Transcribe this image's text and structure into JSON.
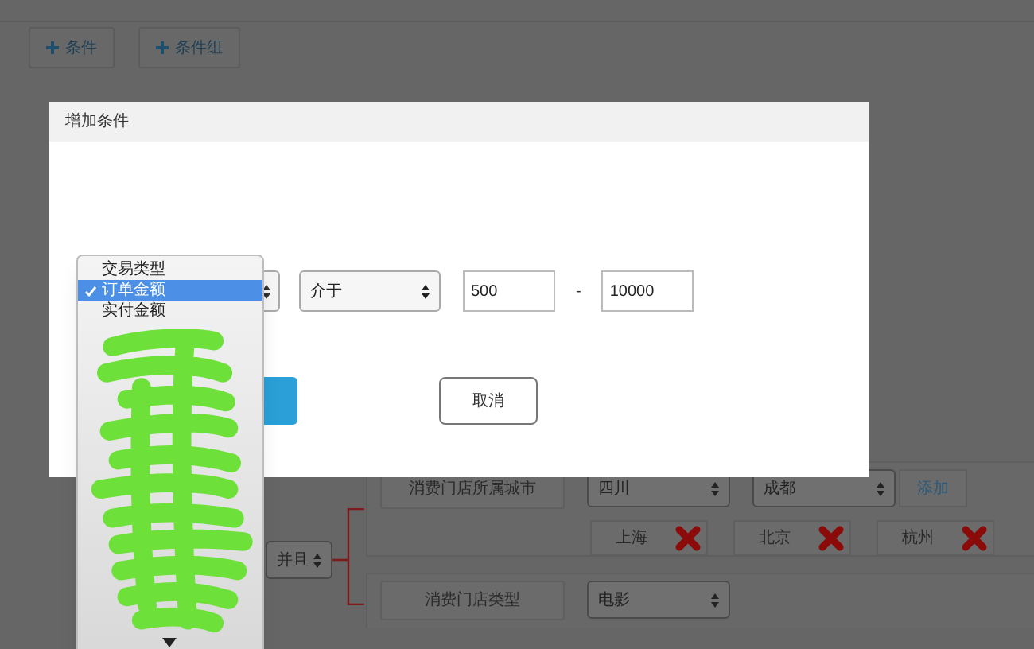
{
  "toolbar": [
    {
      "label": "条件"
    },
    {
      "label": "条件组"
    }
  ],
  "dialog": {
    "title": "增加条件",
    "field_options": [
      {
        "label": "交易类型",
        "selected": false
      },
      {
        "label": "订单金额",
        "selected": true
      },
      {
        "label": "实付金额",
        "selected": false
      }
    ],
    "operator": "介于",
    "min": "500",
    "separator": "-",
    "max": "10000",
    "cancel": "取消"
  },
  "conditions": {
    "joiner": "并且",
    "rows": [
      {
        "label": "消费门店所属城市",
        "selects": [
          "四川",
          "成都"
        ],
        "add": "添加",
        "tags": [
          "上海",
          "北京",
          "杭州"
        ]
      },
      {
        "label": "消费门店类型",
        "selects": [
          "电影"
        ],
        "tags": []
      }
    ]
  }
}
